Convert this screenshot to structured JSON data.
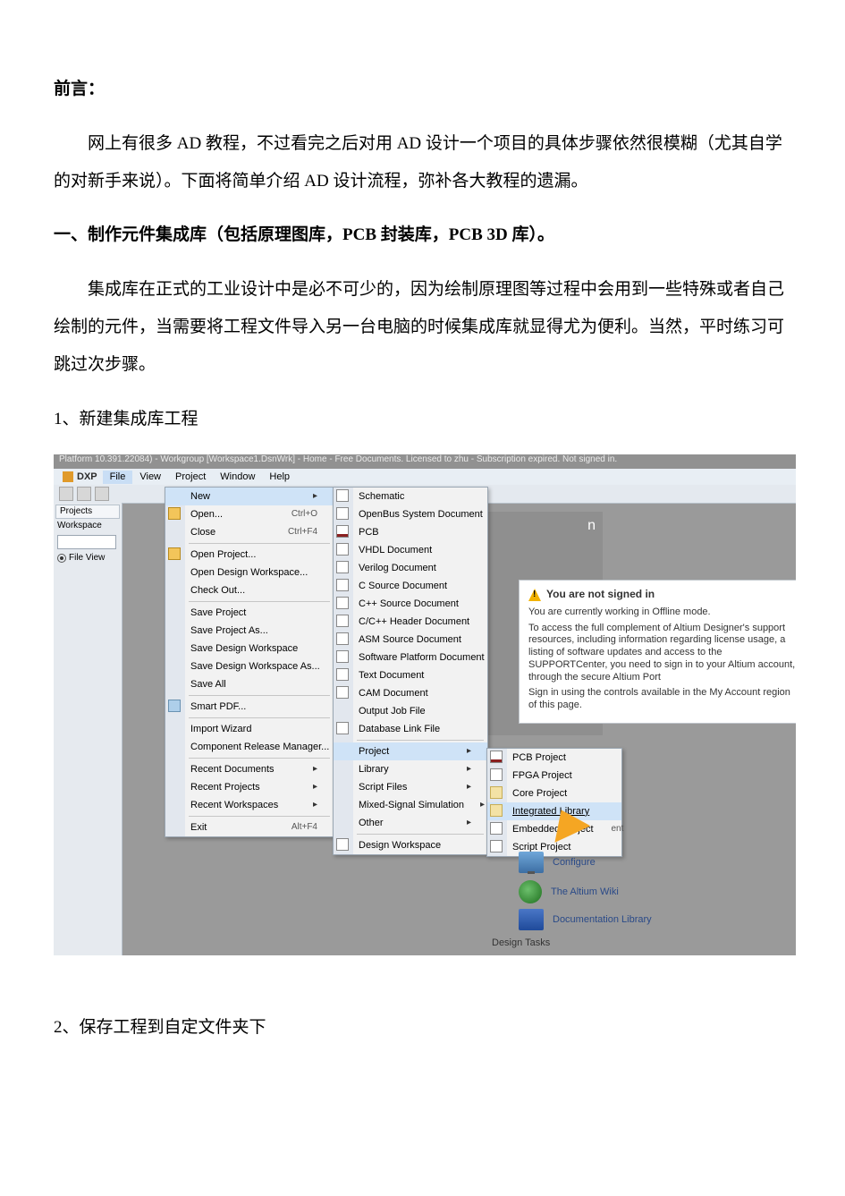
{
  "doc": {
    "preface_label": "前言：",
    "preface_body": "网上有很多 AD 教程，不过看完之后对用 AD 设计一个项目的具体步骤依然很模糊（尤其自学的对新手来说）。下面将简单介绍 AD 设计流程，弥补各大教程的遗漏。",
    "section1_title": "一、制作元件集成库（包括原理图库，PCB 封装库，PCB 3D 库）。",
    "section1_body": "集成库在正式的工业设计中是必不可少的，因为绘制原理图等过程中会用到一些特殊或者自己绘制的元件，当需要将工程文件导入另一台电脑的时候集成库就显得尤为便利。当然，平时练习可跳过次步骤。",
    "step1": "1、新建集成库工程",
    "step2": "2、保存工程到自定文件夹下"
  },
  "shot": {
    "titlebar": "Platform 10.391.22084) - Workgroup [Workspace1.DsnWrk] - Home - Free Documents. Licensed to zhu - Subscription expired. Not signed in.",
    "dxp": "DXP",
    "menubar": {
      "file": "File",
      "view": "View",
      "project": "Project",
      "window": "Window",
      "help": "Help"
    },
    "left": {
      "projects": "Projects",
      "workspace": "Workspace",
      "fileview": "File View"
    },
    "gray_n": "n",
    "file_menu": {
      "new": "New",
      "open": "Open...",
      "open_sc": "Ctrl+O",
      "close": "Close",
      "close_sc": "Ctrl+F4",
      "open_project": "Open Project...",
      "open_ws": "Open Design Workspace...",
      "checkout": "Check Out...",
      "save_project": "Save Project",
      "save_project_as": "Save Project As...",
      "save_ws": "Save Design Workspace",
      "save_ws_as": "Save Design Workspace As...",
      "save_all": "Save All",
      "smart_pdf": "Smart PDF...",
      "import_wizard": "Import Wizard",
      "crm": "Component Release Manager...",
      "recent_docs": "Recent Documents",
      "recent_projects": "Recent Projects",
      "recent_ws": "Recent Workspaces",
      "exit": "Exit",
      "exit_sc": "Alt+F4"
    },
    "new_menu": {
      "schematic": "Schematic",
      "openbus": "OpenBus System Document",
      "pcb": "PCB",
      "vhdl": "VHDL Document",
      "verilog": "Verilog Document",
      "csrc": "C Source Document",
      "cpp": "C++ Source Document",
      "chdr": "C/C++ Header Document",
      "asm": "ASM Source Document",
      "spd": "Software Platform Document",
      "text": "Text Document",
      "cam": "CAM Document",
      "outjob": "Output Job File",
      "dblink": "Database Link File",
      "project": "Project",
      "library": "Library",
      "scripts": "Script Files",
      "mixed": "Mixed-Signal Simulation",
      "other": "Other",
      "design_ws": "Design Workspace"
    },
    "proj_menu": {
      "pcb": "PCB Project",
      "fpga": "FPGA Project",
      "core": "Core Project",
      "intlib": "Integrated Library",
      "embedded": "Embedded Project",
      "script": "Script Project",
      "ent_suffix": "ent"
    },
    "signin": {
      "title": "You are not signed in",
      "line1": "You are currently working in Offline mode.",
      "line2": "To access the full complement of Altium Designer's support resources, including information regarding license usage, a listing of software updates and access to the SUPPORTCenter, you need to sign in to your Altium account, through the secure Altium Port",
      "line3": "Sign in using the controls available in the My Account region of this page."
    },
    "links": {
      "configure": "Configure",
      "wiki": "The Altium Wiki",
      "doclib": "Documentation Library",
      "tasks": "Design Tasks"
    }
  }
}
